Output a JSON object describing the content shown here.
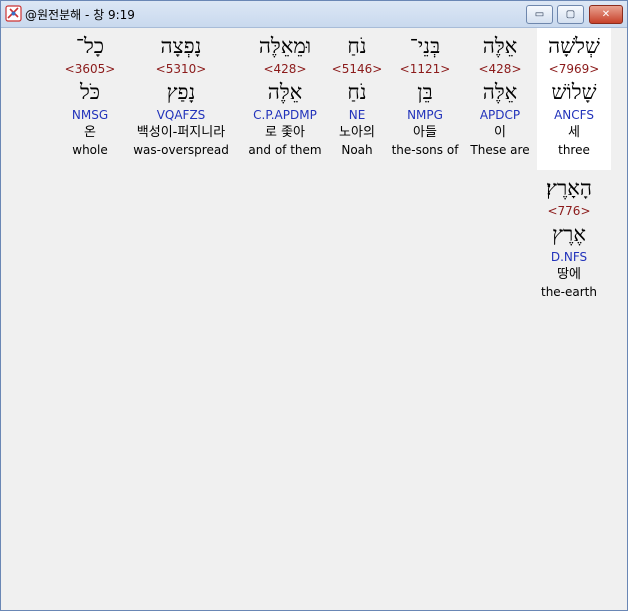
{
  "window": {
    "title": "@원전분해 - 창 9:19",
    "icon": "bible-app-icon"
  },
  "buttons": {
    "minimize": "▭",
    "maximize": "▢",
    "close": "✕"
  },
  "words": [
    {
      "heb": "שְׁלֹשָׁה",
      "strong": "<7969>",
      "lemma": "שָׁלוֹשׁ",
      "morph": "ANCFS",
      "kor": "세",
      "eng": "three"
    },
    {
      "heb": "אֵלֶּה",
      "strong": "<428>",
      "lemma": "אֵלֶּה",
      "morph": "APDCP",
      "kor": "이",
      "eng": "These are"
    },
    {
      "heb": "בְּנֵי־",
      "strong": "<1121>",
      "lemma": "בֵּן",
      "morph": "NMPG",
      "kor": "아들",
      "eng": "the-sons of"
    },
    {
      "heb": "נֹחַ",
      "strong": "<5146>",
      "lemma": "נֹחַ",
      "morph": "NE",
      "kor": "노아의",
      "eng": "Noah"
    },
    {
      "heb": "וּמֵאֵלֶּה",
      "strong": "<428>",
      "lemma": "אֵלֶּה",
      "morph": "C.P.APDMP",
      "kor": "로 좇아",
      "eng": "and of them"
    },
    {
      "heb": "נָפְצָה",
      "strong": "<5310>",
      "lemma": "נָפַץ",
      "morph": "VQAFZS",
      "kor": "백성이-퍼지니라",
      "eng": "was-overspread"
    },
    {
      "heb": "כָל־",
      "strong": "<3605>",
      "lemma": "כֹּל",
      "morph": "NMSG",
      "kor": "온",
      "eng": "whole"
    },
    {
      "heb": "הָאָרֶץ׃",
      "strong": "<776>",
      "lemma": "אֶרֶץ",
      "morph": "D.NFS",
      "kor": "땅에",
      "eng": "the-earth"
    }
  ]
}
